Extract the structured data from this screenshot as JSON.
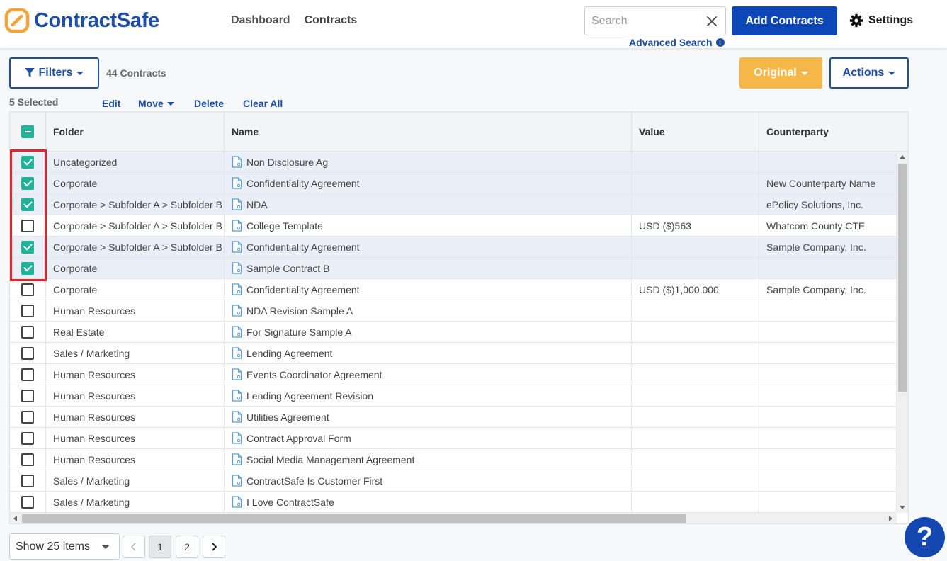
{
  "app": {
    "name": "ContractSafe",
    "nav": [
      "Dashboard",
      "Contracts"
    ],
    "search_placeholder": "Search",
    "advanced_search": "Advanced Search",
    "add_contracts": "Add Contracts",
    "settings": "Settings"
  },
  "toolbar": {
    "filters": "Filters",
    "count": "44 Contracts",
    "original": "Original",
    "actions": "Actions"
  },
  "selection": {
    "label": "5 Selected",
    "edit": "Edit",
    "move": "Move",
    "delete": "Delete",
    "clear_all": "Clear All"
  },
  "columns": [
    "Folder",
    "Name",
    "Value",
    "Counterparty"
  ],
  "rows": [
    {
      "checked": true,
      "folder": "Uncategorized",
      "name": "Non Disclosure Ag",
      "value": "",
      "counterparty": ""
    },
    {
      "checked": true,
      "folder": "Corporate",
      "name": "Confidentiality Agreement",
      "value": "",
      "counterparty": "New Counterparty Name"
    },
    {
      "checked": true,
      "folder": "Corporate > Subfolder A > Subfolder B",
      "name": "NDA",
      "value": "",
      "counterparty": "ePolicy Solutions, Inc."
    },
    {
      "checked": false,
      "folder": "Corporate > Subfolder A > Subfolder B",
      "name": "College Template",
      "value": "USD ($)563",
      "counterparty": "Whatcom County CTE"
    },
    {
      "checked": true,
      "folder": "Corporate > Subfolder A > Subfolder B",
      "name": "Confidentiality Agreement",
      "value": "",
      "counterparty": "Sample Company, Inc."
    },
    {
      "checked": true,
      "folder": "Corporate",
      "name": "Sample Contract B",
      "value": "",
      "counterparty": ""
    },
    {
      "checked": false,
      "folder": "Corporate",
      "name": "Confidentiality Agreement",
      "value": "USD ($)1,000,000",
      "counterparty": "Sample Company, Inc."
    },
    {
      "checked": false,
      "folder": "Human Resources",
      "name": "NDA Revision Sample A",
      "value": "",
      "counterparty": ""
    },
    {
      "checked": false,
      "folder": "Real Estate",
      "name": "For Signature Sample A",
      "value": "",
      "counterparty": ""
    },
    {
      "checked": false,
      "folder": "Sales / Marketing",
      "name": "Lending Agreement",
      "value": "",
      "counterparty": ""
    },
    {
      "checked": false,
      "folder": "Human Resources",
      "name": "Events Coordinator Agreement",
      "value": "",
      "counterparty": ""
    },
    {
      "checked": false,
      "folder": "Human Resources",
      "name": "Lending Agreement Revision",
      "value": "",
      "counterparty": ""
    },
    {
      "checked": false,
      "folder": "Human Resources",
      "name": "Utilities Agreement",
      "value": "",
      "counterparty": ""
    },
    {
      "checked": false,
      "folder": "Human Resources",
      "name": "Contract Approval Form",
      "value": "",
      "counterparty": ""
    },
    {
      "checked": false,
      "folder": "Human Resources",
      "name": "Social Media Management Agreement",
      "value": "",
      "counterparty": ""
    },
    {
      "checked": false,
      "folder": "Sales / Marketing",
      "name": "ContractSafe Is Customer First",
      "value": "",
      "counterparty": ""
    },
    {
      "checked": false,
      "folder": "Sales / Marketing",
      "name": "I Love ContractSafe",
      "value": "",
      "counterparty": ""
    }
  ],
  "pagination": {
    "page_size": "Show 25 items",
    "pages": [
      "1",
      "2"
    ],
    "current_page": "1"
  },
  "help": "?",
  "colors": {
    "brand": "#1e4fa8",
    "primary_button": "#0d47b7",
    "original_button": "#f5b848",
    "checkbox": "#1fb398",
    "highlight": "#e3242b"
  }
}
